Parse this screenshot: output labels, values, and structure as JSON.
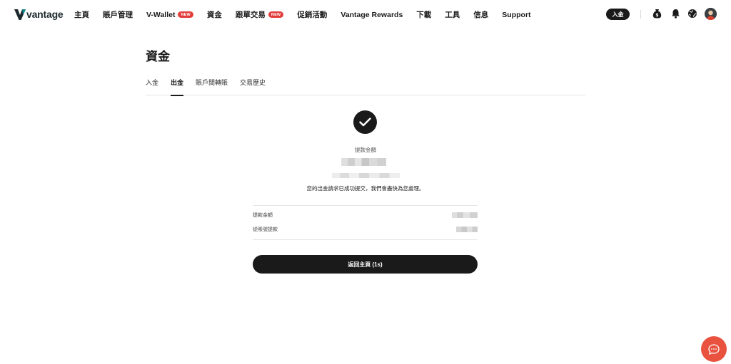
{
  "brand": {
    "name": "vantage",
    "logo_color": "#0e8a8e"
  },
  "nav": {
    "items": [
      {
        "label": "主頁",
        "badge": ""
      },
      {
        "label": "賬戶管理",
        "badge": ""
      },
      {
        "label": "V-Wallet",
        "badge": "NEW"
      },
      {
        "label": "資金",
        "badge": ""
      },
      {
        "label": "跟單交易",
        "badge": "NEW"
      },
      {
        "label": "促銷活動",
        "badge": ""
      },
      {
        "label": "Vantage Rewards",
        "badge": ""
      },
      {
        "label": "下載",
        "badge": ""
      },
      {
        "label": "工具",
        "badge": ""
      },
      {
        "label": "信息",
        "badge": ""
      },
      {
        "label": "Support",
        "badge": ""
      }
    ],
    "deposit_label": "入金",
    "icons": [
      "money-bag-icon",
      "bell-icon",
      "globe-icon",
      "user-avatar-icon"
    ]
  },
  "page": {
    "title": "資金",
    "tabs": [
      {
        "label": "入金",
        "active": false
      },
      {
        "label": "出金",
        "active": true
      },
      {
        "label": "賬戶間轉賬",
        "active": false
      },
      {
        "label": "交易歷史",
        "active": false
      }
    ]
  },
  "result": {
    "icon": "check-circle-icon",
    "amount_label": "提款金額",
    "message": "您的出金請求已成功提交，我們會盡快為您處理。",
    "details": [
      {
        "label": "提款金額"
      },
      {
        "label": "從賬號提款"
      }
    ],
    "home_button": "返回主頁 (1s)"
  },
  "colors": {
    "accent": "#1a1a1a",
    "badge": "#e23d3d",
    "chat": "#e8523f"
  },
  "chat": {
    "icon": "chat-bubble-icon"
  }
}
